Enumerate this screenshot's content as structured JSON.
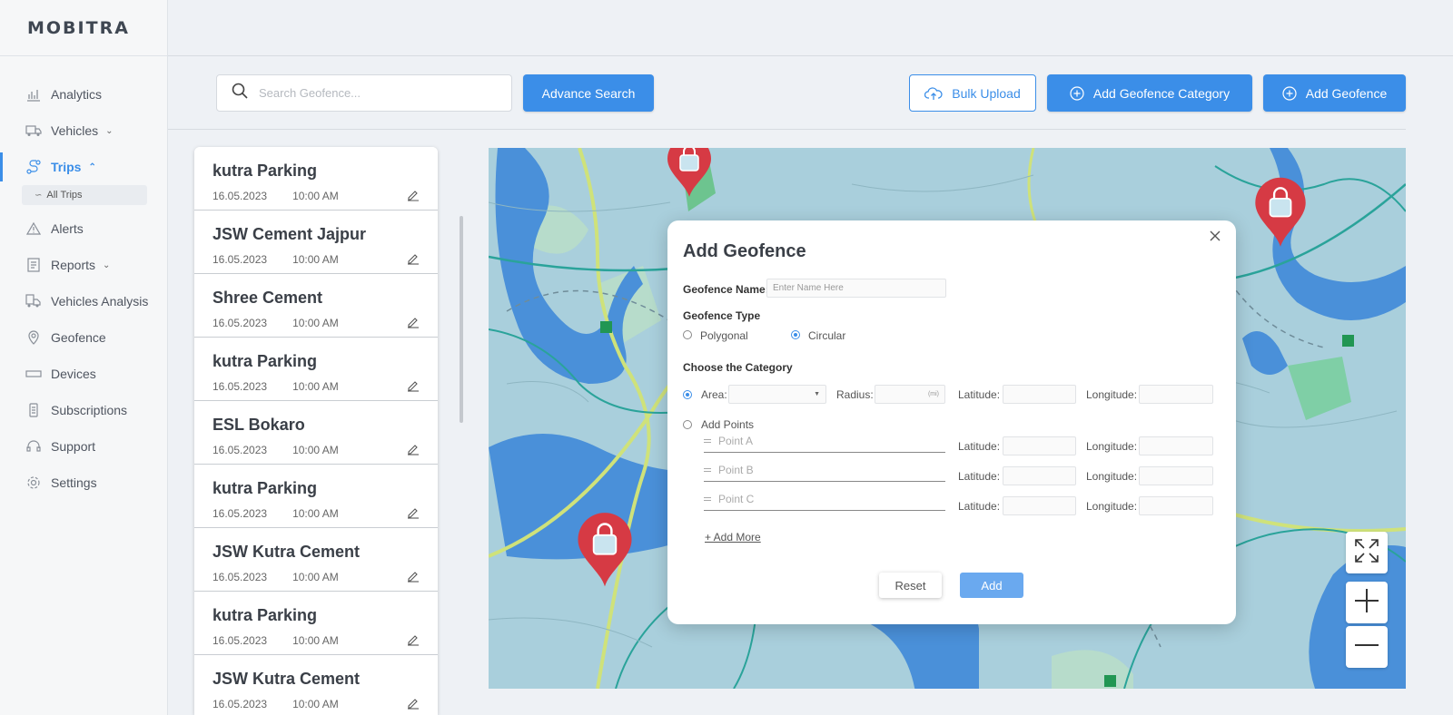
{
  "app": {
    "logo": "MOBITRA"
  },
  "sidebar": {
    "items": [
      {
        "label": "Analytics",
        "icon": "analytics-icon"
      },
      {
        "label": "Vehicles",
        "icon": "truck-icon",
        "chevron": "chevron-down-icon"
      },
      {
        "label": "Trips",
        "icon": "route-icon",
        "chevron": "chevron-up-icon",
        "active": true
      },
      {
        "label": "Alerts",
        "icon": "alert-triangle-icon"
      },
      {
        "label": "Reports",
        "icon": "report-icon",
        "chevron": "chevron-down-icon"
      },
      {
        "label": "Vehicles Analysis",
        "icon": "truck-analysis-icon"
      },
      {
        "label": "Geofence",
        "icon": "map-pin-icon"
      },
      {
        "label": "Devices",
        "icon": "device-icon"
      },
      {
        "label": "Subscriptions",
        "icon": "subscription-icon"
      },
      {
        "label": "Support",
        "icon": "headset-icon"
      },
      {
        "label": "Settings",
        "icon": "gear-icon"
      }
    ],
    "sub_items": [
      {
        "label": "All Trips",
        "icon": "route-icon"
      }
    ]
  },
  "toolbar": {
    "search_placeholder": "Search Geofence...",
    "advance_search": "Advance Search",
    "bulk_upload": "Bulk Upload",
    "add_category": "Add Geofence Category",
    "add_geofence": "Add Geofence"
  },
  "geofences": [
    {
      "name": "kutra Parking",
      "date": "16.05.2023",
      "time": "10:00 AM"
    },
    {
      "name": "JSW Cement Jajpur",
      "date": "16.05.2023",
      "time": "10:00 AM"
    },
    {
      "name": "Shree Cement",
      "date": "16.05.2023",
      "time": "10:00 AM"
    },
    {
      "name": "kutra Parking",
      "date": "16.05.2023",
      "time": "10:00 AM"
    },
    {
      "name": "ESL Bokaro",
      "date": "16.05.2023",
      "time": "10:00 AM"
    },
    {
      "name": "kutra Parking",
      "date": "16.05.2023",
      "time": "10:00 AM"
    },
    {
      "name": "JSW Kutra Cement",
      "date": "16.05.2023",
      "time": "10:00 AM"
    },
    {
      "name": "kutra Parking",
      "date": "16.05.2023",
      "time": "10:00 AM"
    },
    {
      "name": "JSW Kutra Cement",
      "date": "16.05.2023",
      "time": "10:00 AM"
    }
  ],
  "modal": {
    "title": "Add Geofence",
    "name_label": "Geofence Name:",
    "name_placeholder": "Enter Name Here",
    "type_label": "Geofence Type",
    "type_polygonal": "Polygonal",
    "type_circular": "Circular",
    "category_label": "Choose the Category",
    "area_label": "Area:",
    "radius_label": "Radius:",
    "radius_unit": "(mi)",
    "latitude_label": "Latitude:",
    "longitude_label": "Longitude:",
    "add_points_label": "Add Points",
    "points": [
      "Point A",
      "Point B",
      "Point C"
    ],
    "add_more": "+ Add More",
    "reset": "Reset",
    "add": "Add"
  },
  "colors": {
    "accent": "#3b8ee8",
    "map_water": "#4a90d9",
    "map_land": "#a9cfdc",
    "pin": "#d63a44"
  }
}
